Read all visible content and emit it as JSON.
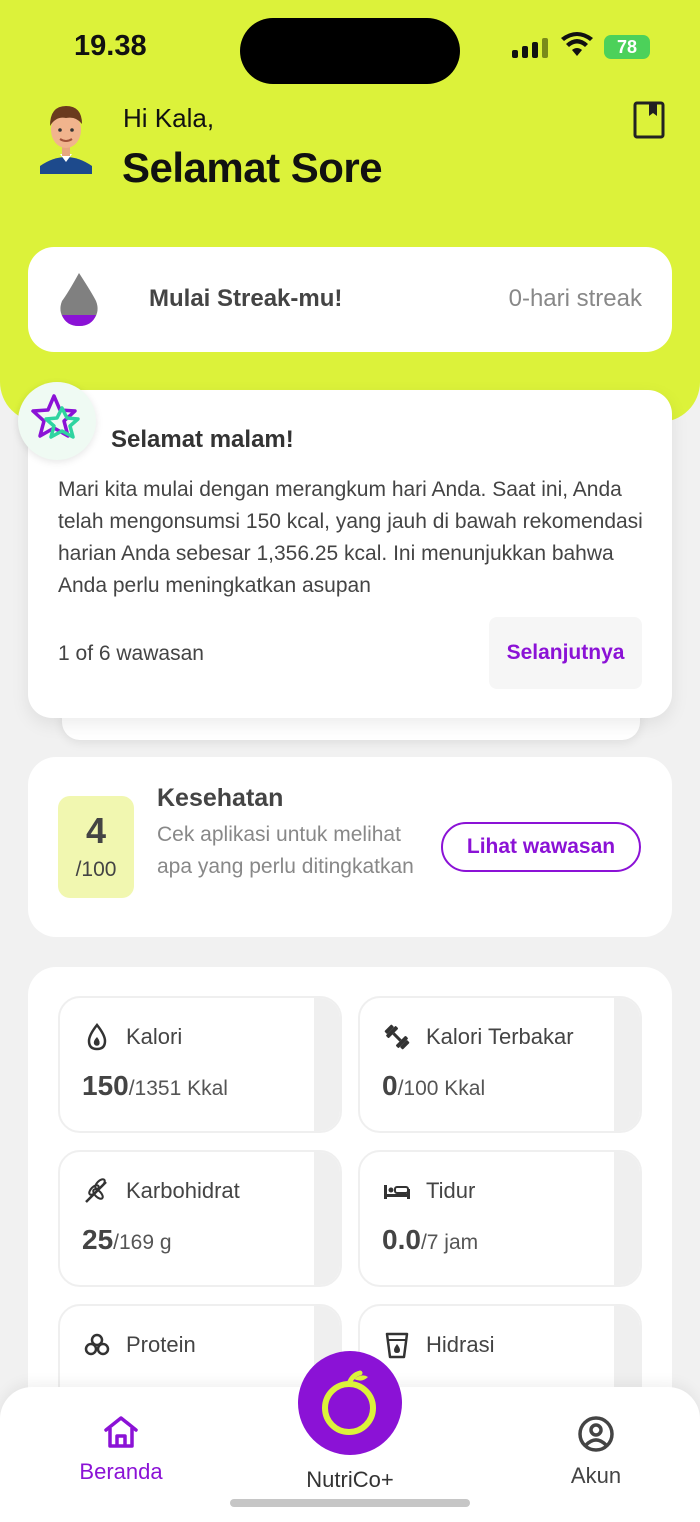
{
  "status_bar": {
    "time": "19.38",
    "battery": "78"
  },
  "header": {
    "greeting": "Hi Kala,",
    "title": "Selamat Sore"
  },
  "streak": {
    "title": "Mulai Streak-mu!",
    "count": "0-hari streak"
  },
  "insight": {
    "title": "Selamat malam!",
    "body": "Mari kita mulai dengan merangkum hari Anda. Saat ini, Anda telah mengonsumsi 150 kcal, yang jauh di bawah rekomendasi harian Anda sebesar 1,356.25 kcal. Ini menunjukkan bahwa Anda perlu meningkatkan asupan",
    "counter": "1 of 6 wawasan",
    "next_label": "Selanjutnya"
  },
  "health": {
    "score": "4",
    "score_max": "/100",
    "title": "Kesehatan",
    "description": "Cek aplikasi untuk melihat apa yang perlu ditingkatkan",
    "button": "Lihat wawasan"
  },
  "stats": [
    {
      "icon": "calorie-drop-icon",
      "label": "Kalori",
      "value": "150",
      "target": "/1351 Kkal"
    },
    {
      "icon": "dumbbell-icon",
      "label": "Kalori Terbakar",
      "value": "0",
      "target": "/100 Kkal"
    },
    {
      "icon": "wheat-icon",
      "label": "Karbohidrat",
      "value": "25",
      "target": "/169 g"
    },
    {
      "icon": "bed-icon",
      "label": "Tidur",
      "value": "0.0",
      "target": "/7 jam"
    },
    {
      "icon": "protein-icon",
      "label": "Protein",
      "value": "",
      "target": ""
    },
    {
      "icon": "glass-icon",
      "label": "Hidrasi",
      "value": "",
      "target": ""
    }
  ],
  "nav": {
    "home": "Beranda",
    "center": "NutriCo+",
    "account": "Akun"
  },
  "colors": {
    "accent": "#8b12d6",
    "lime": "#dcf23a"
  }
}
